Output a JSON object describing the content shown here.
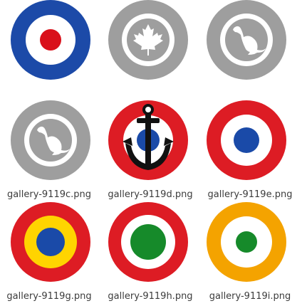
{
  "gallery": {
    "items": [
      {
        "filename": "",
        "icon": "roundel-red-white-blue-icon",
        "colors": {
          "outer": "#1c4aa8",
          "middle": "#ffffff",
          "center": "#d9101a"
        }
      },
      {
        "filename": "",
        "icon": "roundel-maple-leaf-icon",
        "colors": {
          "outer": "#9e9e9e",
          "middle": "#ffffff",
          "center": "#9e9e9e"
        }
      },
      {
        "filename": "",
        "icon": "roundel-kangaroo-icon",
        "colors": {
          "outer": "#9e9e9e",
          "middle": "#ffffff",
          "center": "#9e9e9e"
        }
      },
      {
        "filename": "gallery-9119c.png",
        "icon": "roundel-kangaroo-icon",
        "colors": {
          "outer": "#9e9e9e",
          "middle": "#ffffff",
          "center": "#9e9e9e"
        }
      },
      {
        "filename": "gallery-9119d.png",
        "icon": "roundel-anchor-icon",
        "colors": {
          "outer": "#dd1c24",
          "middle": "#ffffff",
          "center": "#1a4aa8",
          "emblem": "#111111"
        }
      },
      {
        "filename": "gallery-9119e.png",
        "icon": "roundel-red-white-blue-icon",
        "colors": {
          "outer": "#dd1c24",
          "middle": "#ffffff",
          "center": "#1a4aa8"
        }
      },
      {
        "filename": "gallery-9119g.png",
        "icon": "roundel-red-yellow-blue-icon",
        "colors": {
          "outer": "#dd1c24",
          "middle": "#ffd400",
          "center": "#1a4aa8"
        }
      },
      {
        "filename": "gallery-9119h.png",
        "icon": "roundel-red-white-green-icon",
        "colors": {
          "outer": "#dd1c24",
          "middle": "#ffffff",
          "center": "#168a2a"
        }
      },
      {
        "filename": "gallery-9119i.png",
        "icon": "roundel-orange-white-green-icon",
        "colors": {
          "outer": "#f4a300",
          "middle": "#ffffff",
          "center": "#168a2a"
        }
      }
    ]
  }
}
